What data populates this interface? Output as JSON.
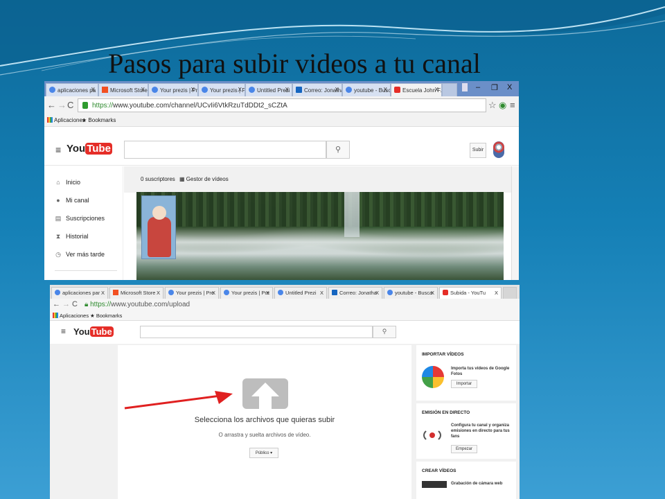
{
  "slide": {
    "title": "Pasos para subir videos a tu canal",
    "colors": {
      "background": "#1580b6",
      "wave": "#dff3fb"
    }
  },
  "shot1": {
    "tabs": [
      {
        "label": "aplicaciones pa",
        "active": false
      },
      {
        "label": "Microsoft Store",
        "active": false
      },
      {
        "label": "Your prezis | Pre",
        "active": false
      },
      {
        "label": "Your prezis | Pre",
        "active": false
      },
      {
        "label": "Untitled Prezi",
        "active": false
      },
      {
        "label": "Correo: Jonatha",
        "active": false
      },
      {
        "label": "youtube - Busca",
        "active": false
      },
      {
        "label": "Escuela John F. K",
        "active": true
      }
    ],
    "tab_close": "X",
    "window_controls": {
      "minimize": "–",
      "restore": "❐",
      "close": "X"
    },
    "url": {
      "scheme": "https://",
      "rest": "www.youtube.com/channel/UCvIi6VtkRzuTdDDt2_sCZtA"
    },
    "bookmarks": [
      "Aplicaciones",
      "Bookmarks"
    ],
    "youtube": {
      "logo_you": "You",
      "logo_tube": "Tube",
      "upload_label": "Subir"
    },
    "sidebar": [
      {
        "icon": "home-icon",
        "glyph": "⌂",
        "label": "Inicio"
      },
      {
        "icon": "user-icon",
        "glyph": "●",
        "label": "Mi canal"
      },
      {
        "icon": "subscriptions-icon",
        "glyph": "▤",
        "label": "Suscripciones"
      },
      {
        "icon": "history-icon",
        "glyph": "⧗",
        "label": "Historial"
      },
      {
        "icon": "watch-later-icon",
        "glyph": "◷",
        "label": "Ver más tarde"
      }
    ],
    "channel": {
      "subscribers": "0 suscriptores",
      "video_manager": "Gestor de vídeos"
    }
  },
  "shot2": {
    "tabs": [
      {
        "label": "aplicaciones par",
        "active": false
      },
      {
        "label": "Microsoft Store",
        "active": false
      },
      {
        "label": "Your prezis | Pre",
        "active": false
      },
      {
        "label": "Your prezis | Pre",
        "active": false
      },
      {
        "label": "Untitled Prezi",
        "active": false
      },
      {
        "label": "Correo: Jonatha",
        "active": false
      },
      {
        "label": "youtube - Busca",
        "active": false
      },
      {
        "label": "Subida - YouTu",
        "active": true
      }
    ],
    "tab_close": "X",
    "url": {
      "scheme": "https://",
      "rest": "www.youtube.com/upload"
    },
    "bookmarks": [
      "Aplicaciones",
      "Bookmarks"
    ],
    "youtube": {
      "logo_you": "You",
      "logo_tube": "Tube"
    },
    "upload": {
      "title": "Selecciona los archivos que quieras subir",
      "subtitle": "O arrastra y suelta archivos de vídeo.",
      "privacy": "Público ▾"
    },
    "cards": {
      "import": {
        "heading": "IMPORTAR VÍDEOS",
        "text": "Importa tus vídeos de Google Fotos",
        "button": "Importar"
      },
      "live": {
        "heading": "EMISIÓN EN DIRECTO",
        "text": "Configura tu canal y organiza emisiones en directo para tus fans",
        "button": "Empezar"
      },
      "create": {
        "heading": "CREAR VÍDEOS",
        "text": "Grabación de cámara web"
      }
    },
    "annotation_color": "#e02020"
  }
}
